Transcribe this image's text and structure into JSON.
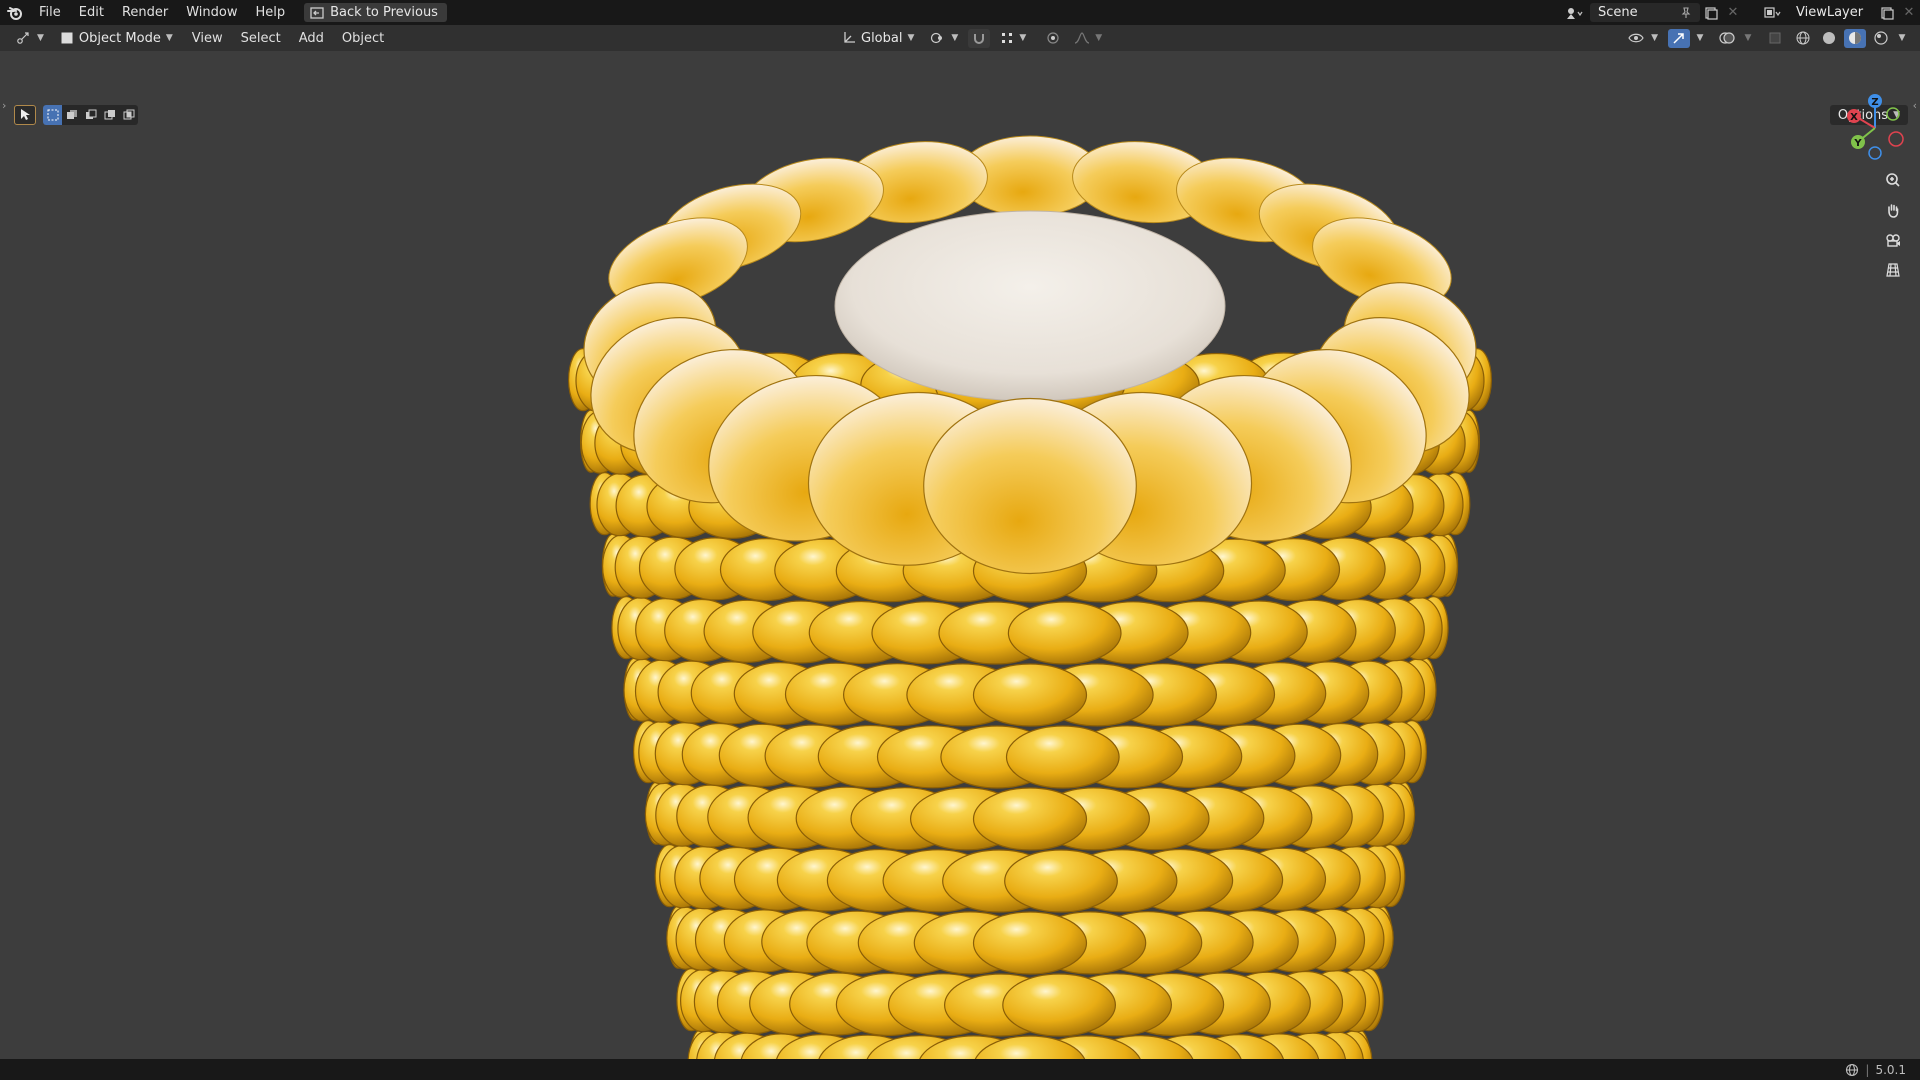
{
  "topbar": {
    "menu": [
      "File",
      "Edit",
      "Render",
      "Window",
      "Help"
    ],
    "back_label": "Back to Previous",
    "scene_name": "Scene",
    "view_layer": "ViewLayer"
  },
  "header": {
    "editor_type_icon": "3d-viewport-icon",
    "mode_label": "Object Mode",
    "menu": [
      "View",
      "Select",
      "Add",
      "Object"
    ],
    "transform_orientation": "Global"
  },
  "tool_settings": {
    "options_label": "Options"
  },
  "status": {
    "version": "5.0.1"
  },
  "gizmo": {
    "axes": [
      "X",
      "Y",
      "Z"
    ],
    "colors": {
      "x": "#e0434f",
      "y": "#80c24a",
      "z": "#3f8fe8"
    }
  },
  "colors": {
    "accent": "#4772b3",
    "kernel": "#f0b820",
    "cob": "#efe9e2",
    "viewport_bg": "#3d3d3d"
  }
}
